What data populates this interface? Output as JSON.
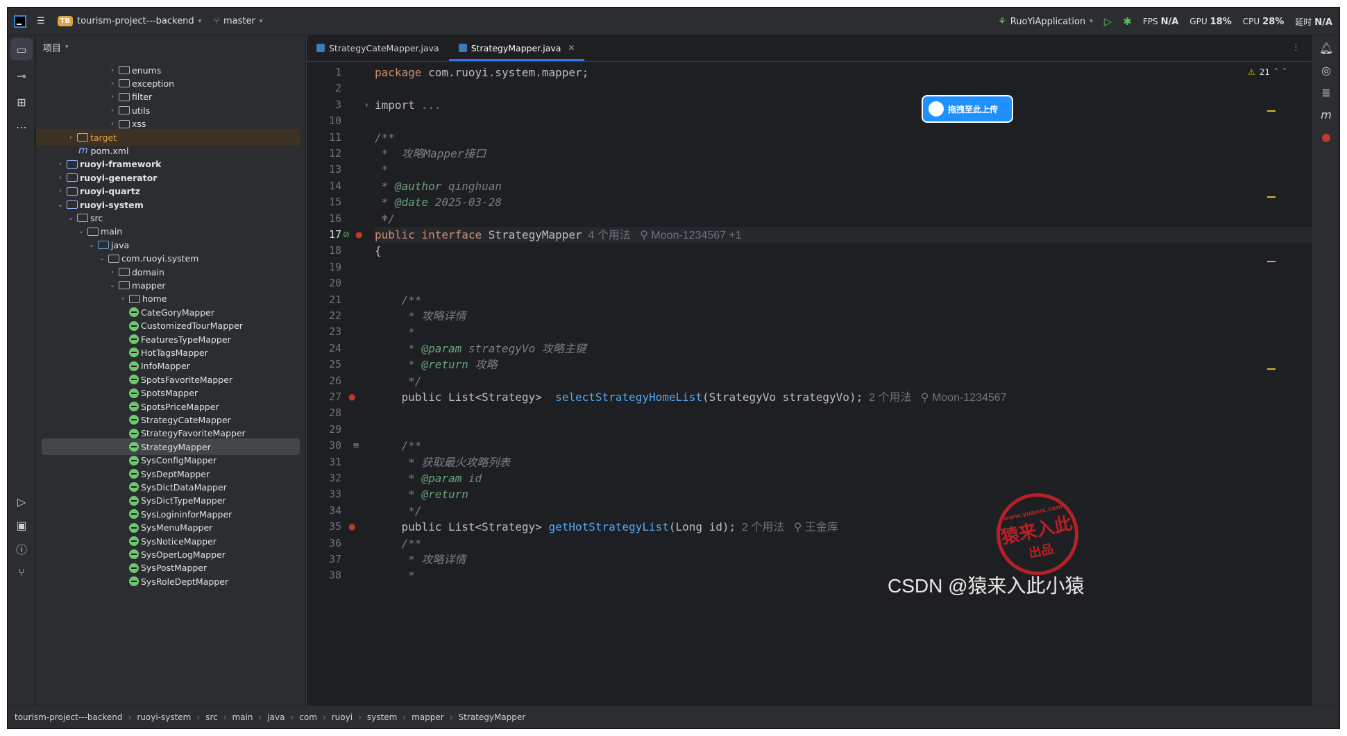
{
  "titlebar": {
    "project_badge": "TB",
    "project_name": "tourism-project---backend",
    "branch": "master",
    "run_config": "RuoYiApplication",
    "metrics": [
      {
        "label": "FPS",
        "value": "N/A"
      },
      {
        "label": "GPU",
        "value": "18%"
      },
      {
        "label": "CPU",
        "value": "28%"
      },
      {
        "label": "延时",
        "value": "N/A"
      }
    ]
  },
  "project_panel": {
    "title": "项目",
    "rows": [
      {
        "depth": 7,
        "arrow": "›",
        "icon": "folder",
        "label": "enums"
      },
      {
        "depth": 7,
        "arrow": "›",
        "icon": "folder",
        "label": "exception"
      },
      {
        "depth": 7,
        "arrow": "›",
        "icon": "folder",
        "label": "filter"
      },
      {
        "depth": 7,
        "arrow": "›",
        "icon": "folder",
        "label": "utils"
      },
      {
        "depth": 7,
        "arrow": "›",
        "icon": "folder",
        "label": "xss"
      },
      {
        "depth": 3,
        "arrow": "›",
        "icon": "folder",
        "label": "target",
        "style": "target"
      },
      {
        "depth": 3,
        "arrow": "",
        "icon": "maven",
        "label": "pom.xml"
      },
      {
        "depth": 2,
        "arrow": "›",
        "icon": "module",
        "label": "ruoyi-framework",
        "style": "bold"
      },
      {
        "depth": 2,
        "arrow": "›",
        "icon": "module",
        "label": "ruoyi-generator",
        "style": "bold"
      },
      {
        "depth": 2,
        "arrow": "›",
        "icon": "module",
        "label": "ruoyi-quartz",
        "style": "bold"
      },
      {
        "depth": 2,
        "arrow": "⌄",
        "icon": "module",
        "label": "ruoyi-system",
        "style": "bold"
      },
      {
        "depth": 3,
        "arrow": "⌄",
        "icon": "folder",
        "label": "src"
      },
      {
        "depth": 4,
        "arrow": "⌄",
        "icon": "folder",
        "label": "main"
      },
      {
        "depth": 5,
        "arrow": "⌄",
        "icon": "source",
        "label": "java"
      },
      {
        "depth": 6,
        "arrow": "⌄",
        "icon": "folder",
        "label": "com.ruoyi.system"
      },
      {
        "depth": 7,
        "arrow": "›",
        "icon": "folder",
        "label": "domain"
      },
      {
        "depth": 7,
        "arrow": "⌄",
        "icon": "folder",
        "label": "mapper"
      },
      {
        "depth": 8,
        "arrow": "›",
        "icon": "folder",
        "label": "home"
      },
      {
        "depth": 8,
        "arrow": "",
        "icon": "interface",
        "label": "CateGoryMapper"
      },
      {
        "depth": 8,
        "arrow": "",
        "icon": "interface",
        "label": "CustomizedTourMapper"
      },
      {
        "depth": 8,
        "arrow": "",
        "icon": "interface",
        "label": "FeaturesTypeMapper"
      },
      {
        "depth": 8,
        "arrow": "",
        "icon": "interface",
        "label": "HotTagsMapper"
      },
      {
        "depth": 8,
        "arrow": "",
        "icon": "interface",
        "label": "InfoMapper"
      },
      {
        "depth": 8,
        "arrow": "",
        "icon": "interface",
        "label": "SpotsFavoriteMapper"
      },
      {
        "depth": 8,
        "arrow": "",
        "icon": "interface",
        "label": "SpotsMapper"
      },
      {
        "depth": 8,
        "arrow": "",
        "icon": "interface",
        "label": "SpotsPriceMapper"
      },
      {
        "depth": 8,
        "arrow": "",
        "icon": "interface",
        "label": "StrategyCateMapper"
      },
      {
        "depth": 8,
        "arrow": "",
        "icon": "interface",
        "label": "StrategyFavoriteMapper"
      },
      {
        "depth": 8,
        "arrow": "",
        "icon": "interface",
        "label": "StrategyMapper",
        "style": "selected"
      },
      {
        "depth": 8,
        "arrow": "",
        "icon": "interface",
        "label": "SysConfigMapper"
      },
      {
        "depth": 8,
        "arrow": "",
        "icon": "interface",
        "label": "SysDeptMapper"
      },
      {
        "depth": 8,
        "arrow": "",
        "icon": "interface",
        "label": "SysDictDataMapper"
      },
      {
        "depth": 8,
        "arrow": "",
        "icon": "interface",
        "label": "SysDictTypeMapper"
      },
      {
        "depth": 8,
        "arrow": "",
        "icon": "interface",
        "label": "SysLogininforMapper"
      },
      {
        "depth": 8,
        "arrow": "",
        "icon": "interface",
        "label": "SysMenuMapper"
      },
      {
        "depth": 8,
        "arrow": "",
        "icon": "interface",
        "label": "SysNoticeMapper"
      },
      {
        "depth": 8,
        "arrow": "",
        "icon": "interface",
        "label": "SysOperLogMapper"
      },
      {
        "depth": 8,
        "arrow": "",
        "icon": "interface",
        "label": "SysPostMapper"
      },
      {
        "depth": 8,
        "arrow": "",
        "icon": "interface",
        "label": "SysRoleDeptMapper"
      }
    ]
  },
  "editor": {
    "tabs": [
      {
        "label": "StrategyCateMapper.java",
        "active": false
      },
      {
        "label": "StrategyMapper.java",
        "active": true
      }
    ],
    "warning_count": "21",
    "upload_button": "拖拽至此上传",
    "lines": [
      {
        "n": "1",
        "segs": [
          [
            "kw",
            "package "
          ],
          [
            "",
            "com.ruoyi.system.mapper;"
          ]
        ]
      },
      {
        "n": "2",
        "segs": []
      },
      {
        "n": "3",
        "segs": [
          [
            "",
            "import "
          ],
          [
            "cm",
            "..."
          ]
        ]
      },
      {
        "n": "10",
        "segs": []
      },
      {
        "n": "11",
        "segs": [
          [
            "cm",
            "/**"
          ]
        ]
      },
      {
        "n": "12",
        "segs": [
          [
            "cm",
            " *  攻略Mapper接口"
          ]
        ]
      },
      {
        "n": "13",
        "segs": [
          [
            "cm",
            " *"
          ]
        ]
      },
      {
        "n": "14",
        "segs": [
          [
            "cm",
            " * "
          ],
          [
            "tag",
            "@author"
          ],
          [
            "cm",
            " qinghuan"
          ]
        ]
      },
      {
        "n": "15",
        "segs": [
          [
            "cm",
            " * "
          ],
          [
            "tag",
            "@date"
          ],
          [
            "cm",
            " 2025-03-28"
          ]
        ]
      },
      {
        "n": "16",
        "segs": [
          [
            "cm",
            " */"
          ]
        ]
      },
      {
        "n": "17",
        "segs": [
          [
            "kw",
            "public interface "
          ],
          [
            "",
            "StrategyMapper"
          ],
          [
            "hint",
            "  4 个用法   ⚲ Moon-1234567 +1"
          ]
        ],
        "current": true
      },
      {
        "n": "18",
        "segs": [
          [
            "",
            "{"
          ]
        ]
      },
      {
        "n": "19",
        "segs": []
      },
      {
        "n": "20",
        "segs": []
      },
      {
        "n": "21",
        "segs": [
          [
            "cm",
            "    /**"
          ]
        ]
      },
      {
        "n": "22",
        "segs": [
          [
            "cm",
            "     * 攻略详情"
          ]
        ]
      },
      {
        "n": "23",
        "segs": [
          [
            "cm",
            "     *"
          ]
        ]
      },
      {
        "n": "24",
        "segs": [
          [
            "cm",
            "     * "
          ],
          [
            "tag",
            "@param"
          ],
          [
            "cm",
            " strategyVo 攻略主键"
          ]
        ]
      },
      {
        "n": "25",
        "segs": [
          [
            "cm",
            "     * "
          ],
          [
            "tag",
            "@return"
          ],
          [
            "cm",
            " 攻略"
          ]
        ]
      },
      {
        "n": "26",
        "segs": [
          [
            "cm",
            "     */"
          ]
        ]
      },
      {
        "n": "27",
        "segs": [
          [
            "",
            "    public List<Strategy>  "
          ],
          [
            "fn",
            "selectStrategyHomeList"
          ],
          [
            "",
            "(StrategyVo strategyVo);"
          ],
          [
            "hint",
            "  2 个用法   ⚲ Moon-1234567"
          ]
        ]
      },
      {
        "n": "28",
        "segs": []
      },
      {
        "n": "29",
        "segs": []
      },
      {
        "n": "30",
        "segs": [
          [
            "cm",
            "    /**"
          ]
        ]
      },
      {
        "n": "31",
        "segs": [
          [
            "cm",
            "     * 获取最火攻略列表"
          ]
        ]
      },
      {
        "n": "32",
        "segs": [
          [
            "cm",
            "     * "
          ],
          [
            "tag",
            "@param"
          ],
          [
            "cm",
            " id"
          ]
        ]
      },
      {
        "n": "33",
        "segs": [
          [
            "cm",
            "     * "
          ],
          [
            "tag",
            "@return"
          ]
        ]
      },
      {
        "n": "34",
        "segs": [
          [
            "cm",
            "     */"
          ]
        ]
      },
      {
        "n": "35",
        "segs": [
          [
            "",
            "    public List<Strategy> "
          ],
          [
            "fn",
            "getHotStrategyList"
          ],
          [
            "",
            "(Long id);"
          ],
          [
            "hint",
            "  2 个用法   ⚲ 王金库"
          ]
        ]
      },
      {
        "n": "36",
        "segs": [
          [
            "cm",
            "    /**"
          ]
        ]
      },
      {
        "n": "37",
        "segs": [
          [
            "cm",
            "     * 攻略详情"
          ]
        ]
      },
      {
        "n": "38",
        "segs": [
          [
            "cm",
            "     *"
          ]
        ]
      }
    ]
  },
  "statusbar": {
    "breadcrumb": [
      "tourism-project---backend",
      "ruoyi-system",
      "src",
      "main",
      "java",
      "com",
      "ruoyi",
      "system",
      "mapper",
      "StrategyMapper"
    ]
  },
  "watermark": "CSDN @猿来入此小猿",
  "stamp": {
    "top": "www.yuanrc.com",
    "mid": "猿来入此",
    "bottom": "出品"
  }
}
